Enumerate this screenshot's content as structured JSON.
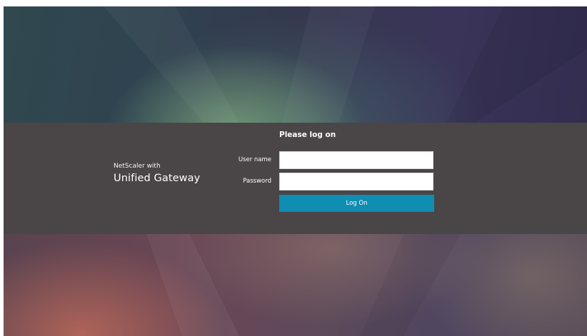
{
  "brand": {
    "product_prefix": "NetScaler with",
    "product_name": "Unified Gateway"
  },
  "login_form": {
    "title": "Please log on",
    "username_label": "User name",
    "username_value": "",
    "password_label": "Password",
    "password_value": "",
    "submit_label": "Log On"
  },
  "colors": {
    "band_background": "#4a4647",
    "button_accent": "#0f8db3",
    "input_background": "#ffffff",
    "text": "#ffffff"
  }
}
